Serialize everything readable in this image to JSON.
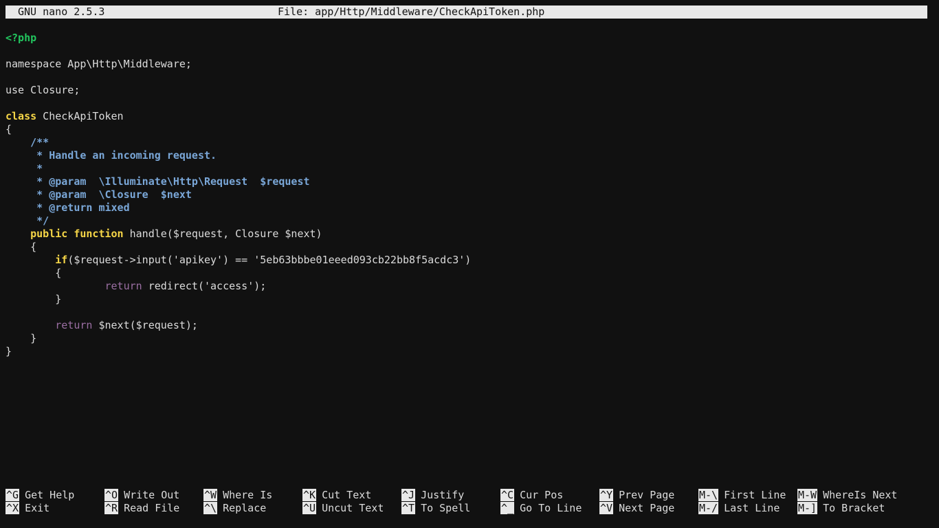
{
  "title": {
    "version": "GNU nano 2.5.3",
    "file": "File: app/Http/Middleware/CheckApiToken.php"
  },
  "code": {
    "l1": "<?php",
    "l3": "namespace App\\Http\\Middleware;",
    "l5": "use Closure;",
    "l7_kw": "class",
    "l7_rest": " CheckApiToken",
    "l8": "{",
    "l9": "    /**",
    "l10": "     * Handle an incoming request.",
    "l11": "     *",
    "l12": "     * @param  \\Illuminate\\Http\\Request  $request",
    "l13": "     * @param  \\Closure  $next",
    "l14": "     * @return mixed",
    "l15": "     */",
    "l16_indent": "    ",
    "l16_kw": "public function",
    "l16_rest": " handle($request, Closure $next)",
    "l17": "    {",
    "l18_indent": "        ",
    "l18_kw": "if",
    "l18_rest": "($request->input('apikey') == '5eb63bbbe01eeed093cb22bb8f5acdc3')",
    "l19": "        {",
    "l20_indent": "                ",
    "l20_kw": "return",
    "l20_rest": " redirect('access');",
    "l21": "        }",
    "l23_indent": "        ",
    "l23_kw": "return",
    "l23_rest": " $next($request);",
    "l24": "    }",
    "l25": "}"
  },
  "shortcuts": {
    "row1": [
      {
        "key": "^G",
        "label": "Get Help"
      },
      {
        "key": "^O",
        "label": "Write Out"
      },
      {
        "key": "^W",
        "label": "Where Is"
      },
      {
        "key": "^K",
        "label": "Cut Text"
      },
      {
        "key": "^J",
        "label": "Justify"
      },
      {
        "key": "^C",
        "label": "Cur Pos"
      },
      {
        "key": "^Y",
        "label": "Prev Page"
      },
      {
        "key": "M-\\",
        "label": "First Line"
      },
      {
        "key": "M-W",
        "label": "WhereIs Next"
      }
    ],
    "row2": [
      {
        "key": "^X",
        "label": "Exit"
      },
      {
        "key": "^R",
        "label": "Read File"
      },
      {
        "key": "^\\",
        "label": "Replace"
      },
      {
        "key": "^U",
        "label": "Uncut Text"
      },
      {
        "key": "^T",
        "label": "To Spell"
      },
      {
        "key": "^_",
        "label": "Go To Line"
      },
      {
        "key": "^V",
        "label": "Next Page"
      },
      {
        "key": "M-/",
        "label": "Last Line"
      },
      {
        "key": "M-]",
        "label": "To Bracket"
      }
    ]
  }
}
